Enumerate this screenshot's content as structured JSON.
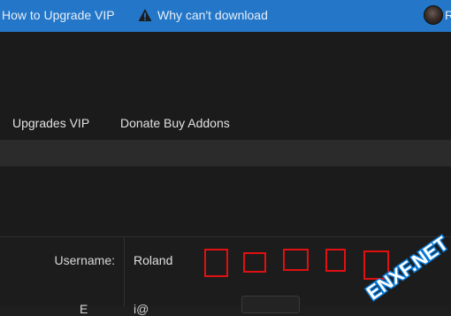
{
  "topbar": {
    "link_upgrade": "How to Upgrade VIP",
    "link_download": "Why can't download",
    "user_initial": "R"
  },
  "nav": {
    "item_upgrades": "Upgrades VIP",
    "item_donate": "Donate Buy Addons"
  },
  "form": {
    "username_label": "Username:",
    "username_value": "Roland",
    "email_label": "E",
    "email_value": "i@"
  },
  "watermark": {
    "text": "ENXF.NET"
  },
  "colors": {
    "topbar": "#2477c8",
    "background": "#1e1e1f",
    "highlight": "#e01010"
  }
}
